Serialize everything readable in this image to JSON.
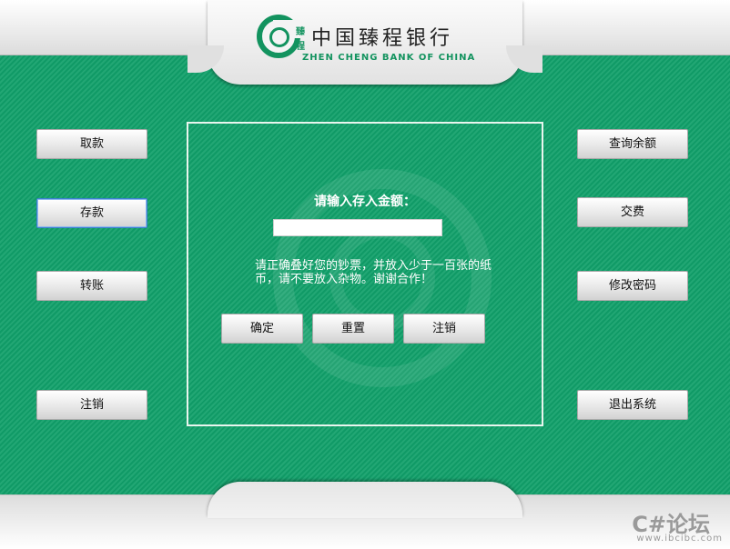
{
  "header": {
    "logo_char_top": "臻",
    "logo_char_bottom": "程",
    "bank_name": "中国臻程银行",
    "bank_name_en": "ZHEN CHENG BANK OF CHINA"
  },
  "left_menu": {
    "withdraw": "取款",
    "deposit": "存款",
    "transfer": "转账",
    "logout": "注销"
  },
  "right_menu": {
    "balance": "查询余额",
    "pay_fees": "交费",
    "change_password": "修改密码",
    "exit": "退出系统"
  },
  "deposit_panel": {
    "prompt": "请输入存入金额：",
    "amount_value": "",
    "notice": "请正确叠好您的钞票，并放入少于一百张的纸币，请不要放入杂物。谢谢合作！",
    "confirm": "确定",
    "reset": "重置",
    "cancel": "注销"
  },
  "watermark": {
    "title": "C#论坛",
    "url": "www.ibcibc.com"
  }
}
